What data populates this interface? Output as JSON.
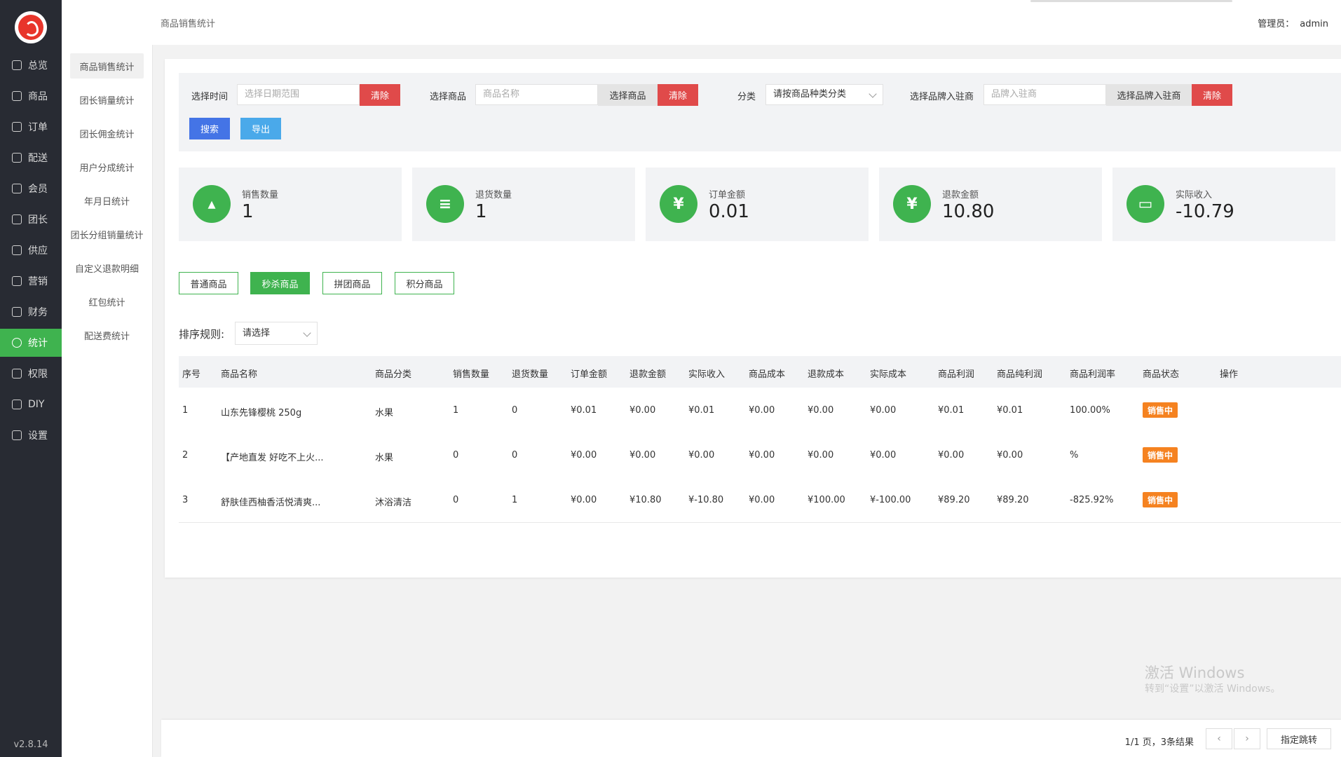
{
  "nav": {
    "items": [
      {
        "label": "总览",
        "icon": "home-icon"
      },
      {
        "label": "商品",
        "icon": "goods-icon"
      },
      {
        "label": "订单",
        "icon": "order-icon"
      },
      {
        "label": "配送",
        "icon": "delivery-icon"
      },
      {
        "label": "会员",
        "icon": "member-icon"
      },
      {
        "label": "团长",
        "icon": "leader-icon"
      },
      {
        "label": "供应",
        "icon": "supply-icon"
      },
      {
        "label": "营销",
        "icon": "gift-icon"
      },
      {
        "label": "财务",
        "icon": "finance-icon"
      },
      {
        "label": "统计",
        "icon": "chart-pie-icon"
      },
      {
        "label": "权限",
        "icon": "permission-icon"
      },
      {
        "label": "DIY",
        "icon": "diy-icon"
      },
      {
        "label": "设置",
        "icon": "gear-icon"
      }
    ],
    "version": "v2.8.14"
  },
  "subnav": {
    "items": [
      "商品销售统计",
      "团长销量统计",
      "团长佣金统计",
      "用户分成统计",
      "年月日统计",
      "团长分组销量统计",
      "自定义退款明细",
      "红包统计",
      "配送费统计"
    ]
  },
  "header": {
    "breadcrumb": "商品销售统计",
    "admin_label": "管理员：",
    "admin_name": "admin"
  },
  "filter": {
    "time_label": "选择时间",
    "time_placeholder": "选择日期范围",
    "clear": "清除",
    "goods_label": "选择商品",
    "goods_placeholder": "商品名称",
    "goods_select": "选择商品",
    "category_label": "分类",
    "category_value": "请按商品种类分类",
    "brand_label": "选择品牌入驻商",
    "brand_placeholder": "品牌入驻商",
    "brand_select": "选择品牌入驻商",
    "search": "搜索",
    "export": "导出"
  },
  "stats": [
    {
      "label": "销售数量",
      "value": "1",
      "icon": "sales-chart-icon"
    },
    {
      "label": "退货数量",
      "value": "1",
      "icon": "return-doc-icon"
    },
    {
      "label": "订单金额",
      "value": "0.01",
      "icon": "money-bag-icon"
    },
    {
      "label": "退款金额",
      "value": "10.80",
      "icon": "refund-bag-icon"
    },
    {
      "label": "实际收入",
      "value": "-10.79",
      "icon": "wallet-icon"
    }
  ],
  "tabs": [
    "普通商品",
    "秒杀商品",
    "拼团商品",
    "积分商品"
  ],
  "sort": {
    "label": "排序规则:",
    "value": "请选择"
  },
  "table": {
    "headers": [
      "序号",
      "商品名称",
      "商品分类",
      "销售数量",
      "退货数量",
      "订单金额",
      "退款金额",
      "实际收入",
      "商品成本",
      "退款成本",
      "实际成本",
      "商品利润",
      "商品纯利润",
      "商品利润率",
      "商品状态",
      "操作"
    ],
    "rows": [
      [
        "1",
        "山东先锋樱桃 250g",
        "水果",
        "1",
        "0",
        "¥0.01",
        "¥0.00",
        "¥0.01",
        "¥0.00",
        "¥0.00",
        "¥0.00",
        "¥0.01",
        "¥0.01",
        "100.00%",
        "销售中"
      ],
      [
        "2",
        "【产地直发 好吃不上火...",
        "水果",
        "0",
        "0",
        "¥0.00",
        "¥0.00",
        "¥0.00",
        "¥0.00",
        "¥0.00",
        "¥0.00",
        "¥0.00",
        "¥0.00",
        "%",
        "销售中"
      ],
      [
        "3",
        "舒肤佳西柚香活悦清爽...",
        "沐浴清洁",
        "0",
        "1",
        "¥0.00",
        "¥10.80",
        "¥-10.80",
        "¥0.00",
        "¥100.00",
        "¥-100.00",
        "¥89.20",
        "¥89.20",
        "-825.92%",
        "销售中"
      ]
    ]
  },
  "watermark": {
    "line1": "激活 Windows",
    "line2": "转到“设置”以激活 Windows。"
  },
  "pagination": {
    "info": "1/1 页，3条结果",
    "prev": "‹",
    "next": "›",
    "jump": "指定跳转"
  },
  "colors": {
    "primary": "#3fb34f",
    "nav_bg": "#282b33",
    "danger": "#e04a4a",
    "blue": "#4474e6",
    "cyan": "#4aa9ea",
    "badge": "#f58220"
  }
}
